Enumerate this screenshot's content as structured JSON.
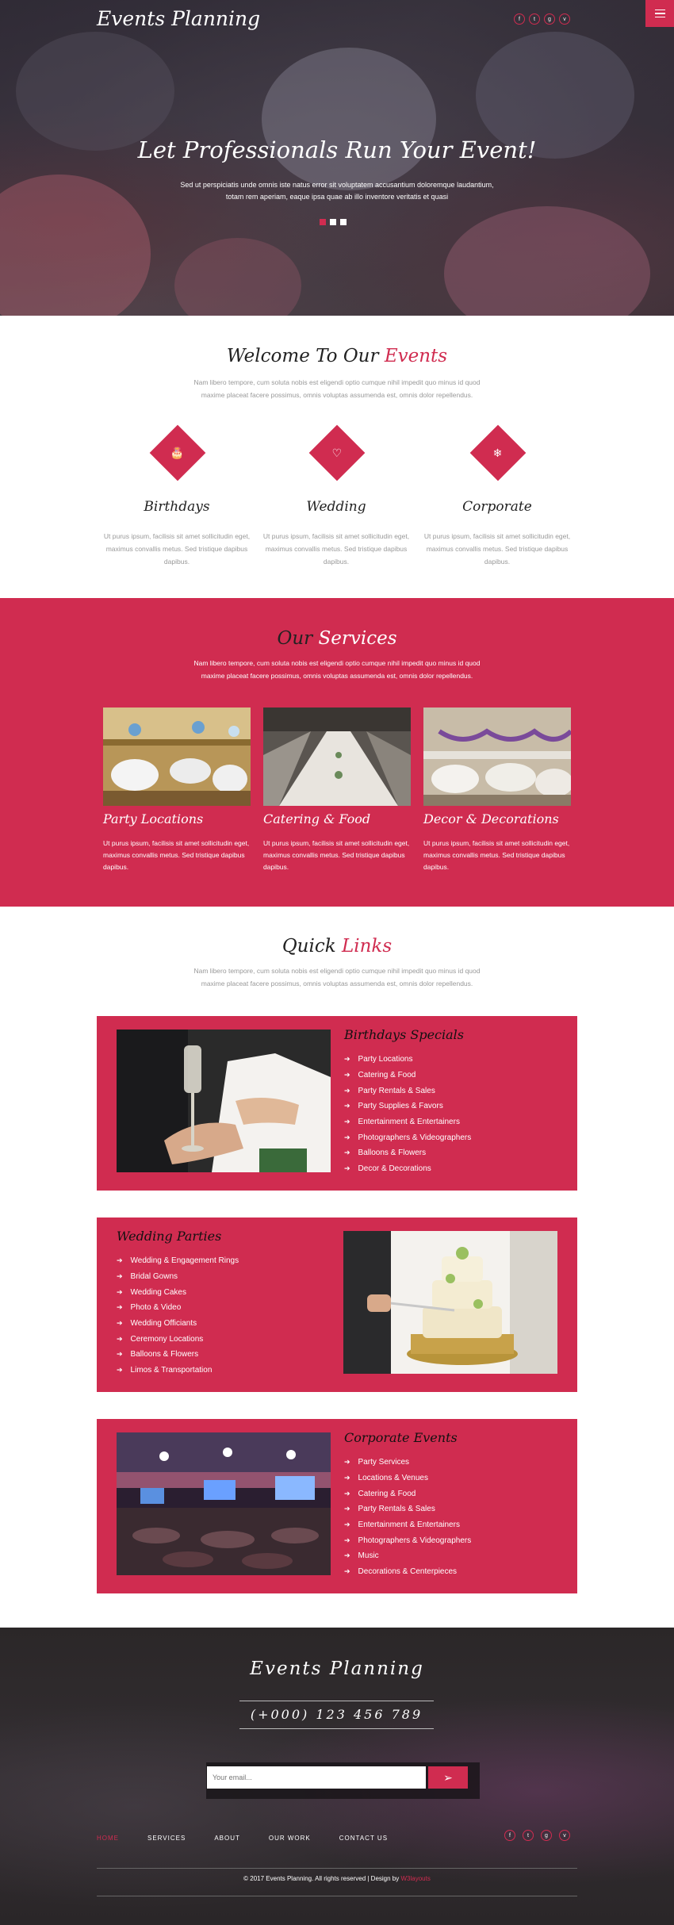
{
  "header": {
    "logo": "Events Planning",
    "social_icons": [
      "f",
      "t",
      "g",
      "v"
    ],
    "menu_icon": "hamburger-menu-icon"
  },
  "hero": {
    "title": "Let Professionals Run Your Event!",
    "text": "Sed ut perspiciatis unde omnis iste natus error sit voluptatem accusantium doloremque laudantium, totam rem aperiam, eaque ipsa quae ab illo inventore veritatis et quasi",
    "slide_count": 3,
    "active_slide": 1
  },
  "welcome": {
    "title_plain": "Welcome To Our",
    "title_accent": "Events",
    "subtitle": "Nam libero tempore, cum soluta nobis est eligendi optio cumque nihil impedit quo minus id quod maxime placeat facere possimus, omnis voluptas assumenda est, omnis dolor repellendus.",
    "features": [
      {
        "icon": "cake-icon",
        "glyph": "🎂",
        "title": "Birthdays",
        "text": "Ut purus ipsum, facilisis sit amet sollicitudin eget, maximus convallis metus. Sed tristique dapibus dapibus."
      },
      {
        "icon": "heart-icon",
        "glyph": "♡",
        "title": "Wedding",
        "text": "Ut purus ipsum, facilisis sit amet sollicitudin eget, maximus convallis metus. Sed tristique dapibus dapibus."
      },
      {
        "icon": "snowflake-icon",
        "glyph": "❄",
        "title": "Corporate",
        "text": "Ut purus ipsum, facilisis sit amet sollicitudin eget, maximus convallis metus. Sed tristique dapibus dapibus."
      }
    ]
  },
  "services": {
    "title_plain": "Our",
    "title_accent": "Services",
    "subtitle": "Nam libero tempore, cum soluta nobis est eligendi optio cumque nihil impedit quo minus id quod maxime placeat facere possimus, omnis voluptas assumenda est, omnis dolor repellendus.",
    "items": [
      {
        "title": "Party Locations",
        "text": "Ut purus ipsum, facilisis sit amet sollicitudin eget, maximus convallis metus. Sed tristique dapibus dapibus."
      },
      {
        "title": "Catering & Food",
        "text": "Ut purus ipsum, facilisis sit amet sollicitudin eget, maximus convallis metus. Sed tristique dapibus dapibus."
      },
      {
        "title": "Decor & Decorations",
        "text": "Ut purus ipsum, facilisis sit amet sollicitudin eget, maximus convallis metus. Sed tristique dapibus dapibus."
      }
    ]
  },
  "quick_links": {
    "title_plain": "Quick",
    "title_accent": "Links",
    "subtitle": "Nam libero tempore, cum soluta nobis est eligendi optio cumque nihil impedit quo minus id quod maxime placeat facere possimus, omnis voluptas assumenda est, omnis dolor repellendus.",
    "boxes": [
      {
        "title": "Birthdays Specials",
        "items": [
          "Party Locations",
          "Catering & Food",
          "Party Rentals & Sales",
          "Party Supplies & Favors",
          "Entertainment & Entertainers",
          "Photographers & Videographers",
          "Balloons & Flowers",
          "Decor & Decorations"
        ]
      },
      {
        "title": "Wedding Parties",
        "items": [
          "Wedding & Engagement Rings",
          "Bridal Gowns",
          "Wedding Cakes",
          "Photo & Video",
          "Wedding Officiants",
          "Ceremony Locations",
          "Balloons & Flowers",
          "Limos & Transportation"
        ]
      },
      {
        "title": "Corporate Events",
        "items": [
          "Party Services",
          "Locations & Venues",
          "Catering & Food",
          "Party Rentals & Sales",
          "Entertainment & Entertainers",
          "Photographers & Videographers",
          "Music",
          "Decorations & Centerpieces"
        ]
      }
    ]
  },
  "footer": {
    "logo": "Events Planning",
    "phone": "(+000) 123 456 789",
    "email_placeholder": "Your email...",
    "nav": [
      "HOME",
      "SERVICES",
      "ABOUT",
      "OUR WORK",
      "CONTACT US"
    ],
    "active_nav": 0,
    "social_icons": [
      "f",
      "t",
      "g",
      "v"
    ],
    "copyright": "© 2017 Events Planning. All rights reserved | Design by",
    "copyright_link": "W3layouts"
  },
  "colors": {
    "accent": "#d02c50",
    "dark": "#2b2728"
  }
}
